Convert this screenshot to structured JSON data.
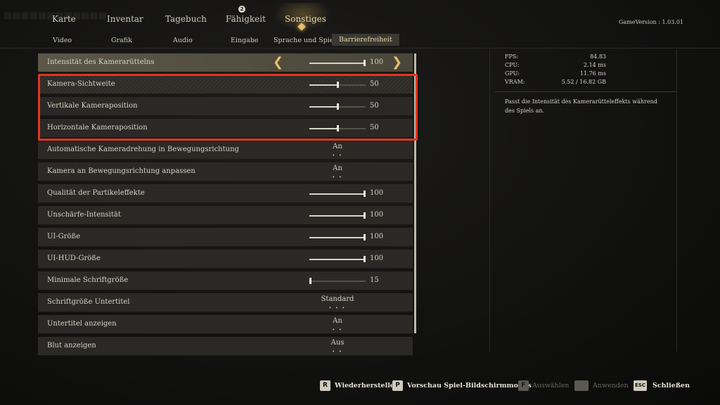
{
  "nav": {
    "main_tabs": [
      {
        "label": "Karte"
      },
      {
        "label": "Inventar"
      },
      {
        "label": "Tagebuch"
      },
      {
        "label": "Fähigkeit"
      },
      {
        "label": "Sonstiges"
      }
    ],
    "fahigkeit_marker": "2",
    "sub_tabs": [
      {
        "label": "Video"
      },
      {
        "label": "Grafik"
      },
      {
        "label": "Audio"
      },
      {
        "label": "Eingabe"
      },
      {
        "label": "Sprache und Spiel"
      },
      {
        "label": "Barrierefreiheit"
      }
    ],
    "game_version": "GameVersion : 1.03.01"
  },
  "settings": [
    {
      "label": "Intensität des Kamerarüttelns",
      "type": "slider",
      "value": "100",
      "level": 1.0
    },
    {
      "label": "Kamera-Sichtweite",
      "type": "slider",
      "value": "50",
      "level": 0.5
    },
    {
      "label": "Vertikale Kameraposition",
      "type": "slider",
      "value": "50",
      "level": 0.5
    },
    {
      "label": "Horizontale Kameraposition",
      "type": "slider",
      "value": "50",
      "level": 0.5
    },
    {
      "label": "Automatische Kameradrehung in Bewegungsrichtung",
      "type": "toggle",
      "value": "An"
    },
    {
      "label": "Kamera an Bewegungsrichtung anpassen",
      "type": "toggle",
      "value": "An"
    },
    {
      "label": "Qualität der Partikeleffekte",
      "type": "slider",
      "value": "100",
      "level": 1.0
    },
    {
      "label": "Unschärfe-Intensität",
      "type": "slider",
      "value": "100",
      "level": 1.0
    },
    {
      "label": "UI-Größe",
      "type": "slider",
      "value": "100",
      "level": 1.0
    },
    {
      "label": "UI-HUD-Größe",
      "type": "slider",
      "value": "100",
      "level": 1.0
    },
    {
      "label": "Minimale Schriftgröße",
      "type": "slider",
      "value": "15",
      "level": 0.0
    },
    {
      "label": "Schriftgröße Untertitel",
      "type": "toggle",
      "value": "Standard"
    },
    {
      "label": "Untertitel anzeigen",
      "type": "toggle",
      "value": "An"
    },
    {
      "label": "Blut anzeigen",
      "type": "toggle",
      "value": "Aus"
    }
  ],
  "arrows": {
    "left": "❮",
    "right": "❯"
  },
  "stats": [
    {
      "label": "FPS:",
      "value": "84.83"
    },
    {
      "label": "CPU:",
      "value": "2.14 ms"
    },
    {
      "label": "GPU:",
      "value": "11.76 ms"
    },
    {
      "label": "VRAM:",
      "value": "5.52 / 16.82 GB"
    }
  ],
  "description": "Passt die Intensität des Kamerarütteleffekts während des Spiels an.",
  "footer": [
    {
      "key": "R",
      "label": "Wiederherstellen",
      "enabled": true
    },
    {
      "key": "P",
      "label": "Vorschau Spiel-Bildschirmmodus",
      "enabled": true
    },
    {
      "key": "F",
      "label": "Auswählen",
      "enabled": false
    },
    {
      "key": "",
      "label": "Anwenden",
      "enabled": false
    },
    {
      "key": "ESC",
      "label": "Schließen",
      "enabled": true
    }
  ],
  "colors": {
    "accent": "#e6c06a",
    "highlight": "#e0351f",
    "panel_row": "#2a2926"
  }
}
